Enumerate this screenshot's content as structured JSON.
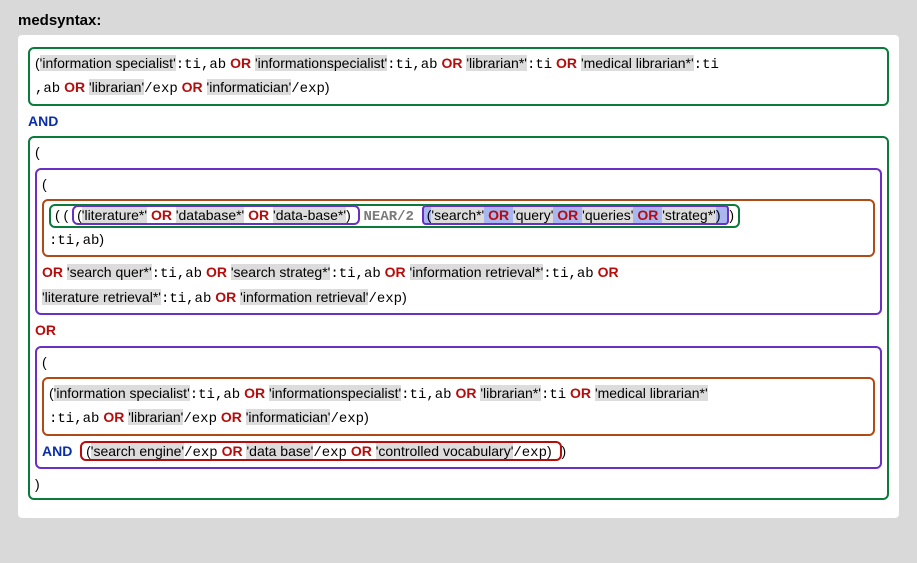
{
  "title": "medsyntax:",
  "ops": {
    "and": "AND",
    "or": "OR",
    "near2": "NEAR/2"
  },
  "fields": {
    "tiab": ":ti,ab",
    "ti": ":ti",
    "exp": "/exp"
  },
  "block1": {
    "t1": "'information specialist'",
    "t2": "'informationspecialist'",
    "t3": "'librarian*'",
    "t4": "'medical librarian*'",
    "t5": "'librarian'",
    "t6": "'informatician'"
  },
  "block2": {
    "near_left": {
      "a": "'literature*'",
      "b": "'database*'",
      "c": "'data-base*'"
    },
    "near_right": {
      "a": "'search*'",
      "b": "'query'",
      "c": "'queries'",
      "d": "'strateg*'"
    },
    "extra": {
      "a": "'search quer*'",
      "b": "'search strateg*'",
      "c": "'information retrieval*'",
      "d": "'literature retrieval*'",
      "e": "'information retrieval'"
    }
  },
  "block3": {
    "top": {
      "a": "'information specialist'",
      "b": "'informationspecialist'",
      "c": "'librarian*'",
      "d": "'medical librarian*'",
      "e": "'librarian'",
      "f": "'informatician'"
    },
    "bottom": {
      "a": "'search engine'",
      "b": "'data base'",
      "c": "'controlled vocabulary'"
    }
  }
}
